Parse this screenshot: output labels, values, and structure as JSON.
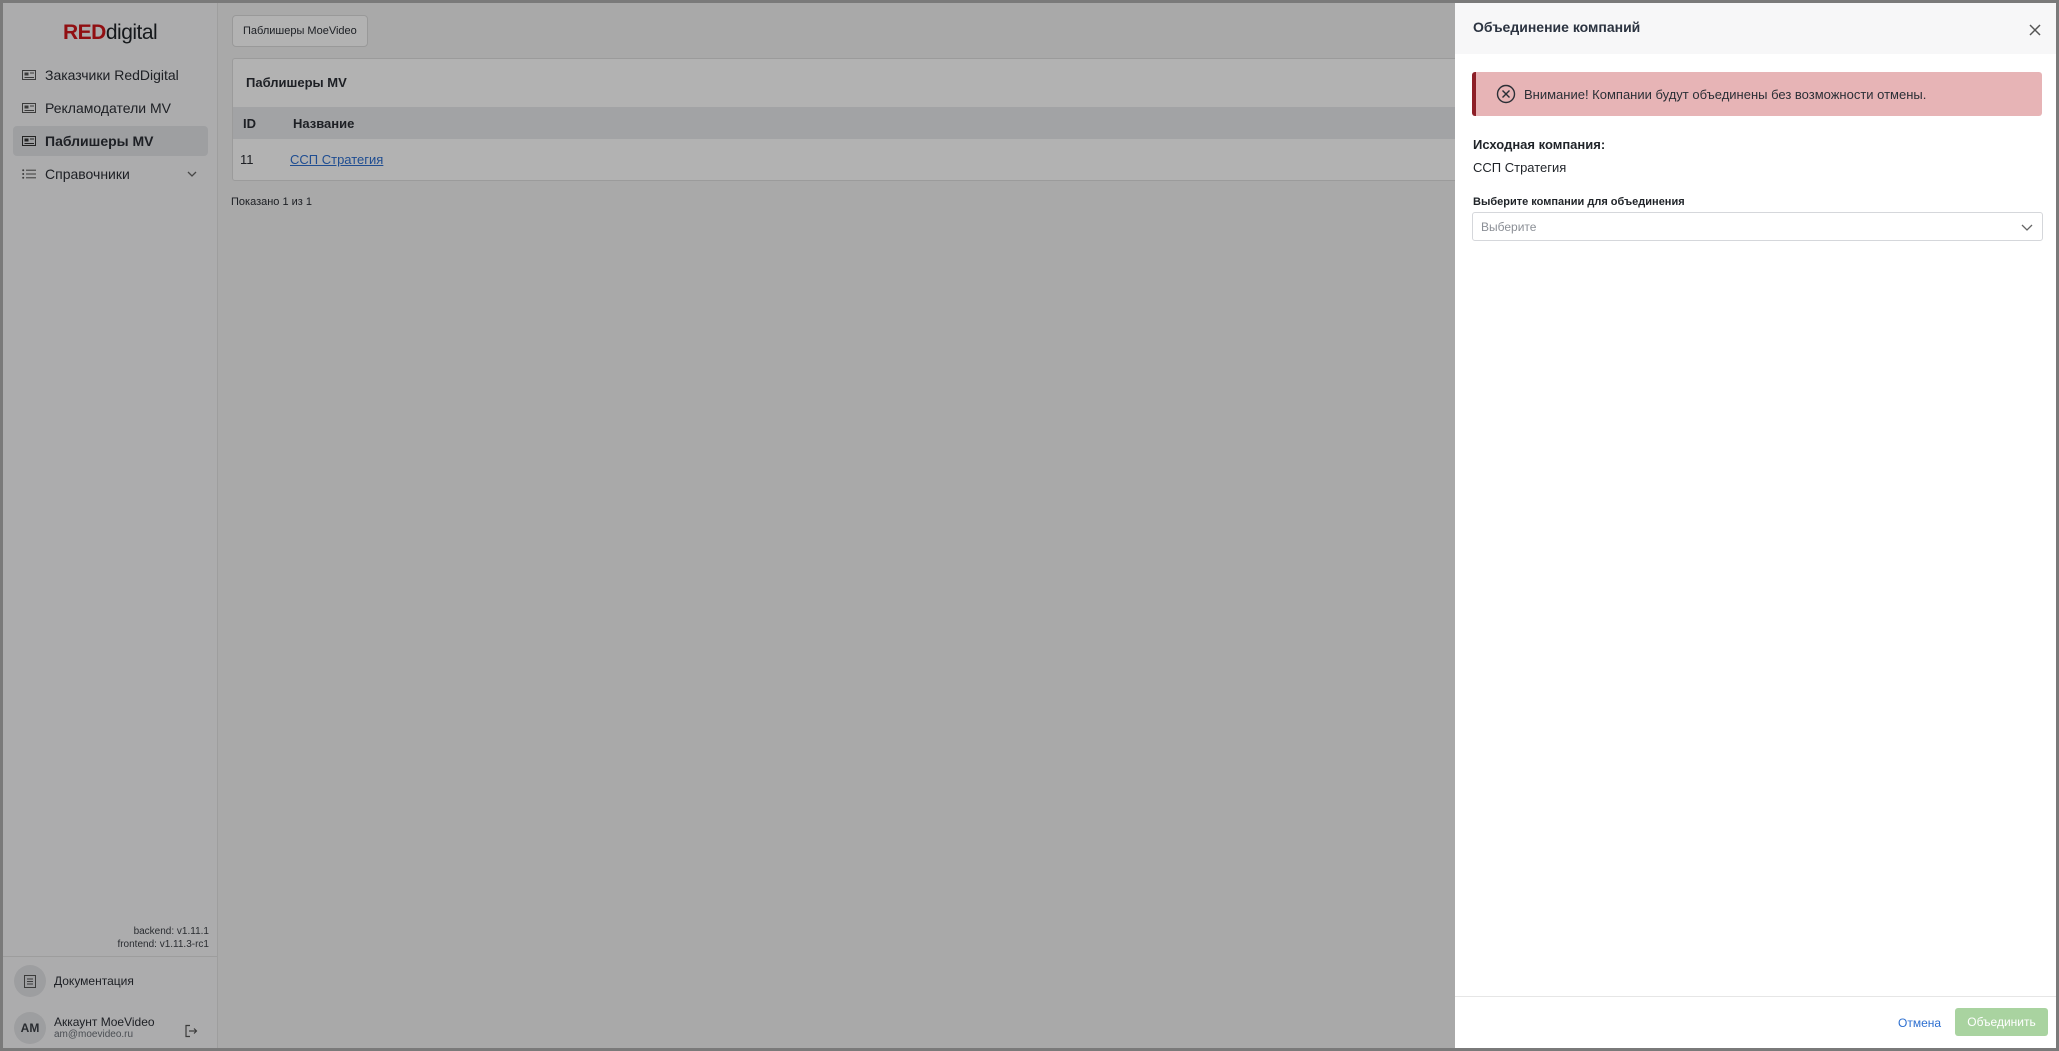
{
  "logo": {
    "red": "RED",
    "rest": "digital"
  },
  "sidebar": {
    "items": [
      {
        "label": "Заказчики RedDigital",
        "icon": "card-icon"
      },
      {
        "label": "Рекламодатели MV",
        "icon": "card-icon"
      },
      {
        "label": "Паблишеры MV",
        "icon": "card-icon",
        "active": true
      },
      {
        "label": "Справочники",
        "icon": "list-icon",
        "expandable": true
      }
    ],
    "versions": {
      "backend": "backend: v1.11.1",
      "frontend": "frontend: v1.11.3-rc1"
    },
    "docs_label": "Документация",
    "account": {
      "initials": "AM",
      "name": "Аккаунт MoeVideo",
      "email": "am@moevideo.ru"
    }
  },
  "main": {
    "breadcrumb": "Паблишеры MoeVideo",
    "panel_title": "Паблишеры MV",
    "columns": [
      "ID",
      "Название"
    ],
    "rows": [
      {
        "id": "11",
        "name": "ССП Стратегия"
      }
    ],
    "shown": "Показано 1 из 1"
  },
  "drawer": {
    "title": "Объединение компаний",
    "alert": "Внимание! Компании будут объединены без возможности отмены.",
    "source_label": "Исходная компания:",
    "source_value": "ССП Стратегия",
    "select_label": "Выберите компании для объединения",
    "select_placeholder": "Выберите",
    "cancel_label": "Отмена",
    "merge_label": "Объединить"
  },
  "colors": {
    "brand_red": "#d0161b",
    "alert_bg": "#e7b4b6",
    "alert_border": "#8d1f27",
    "link": "#2d6fd0",
    "merge_disabled": "#a9d3a0"
  }
}
